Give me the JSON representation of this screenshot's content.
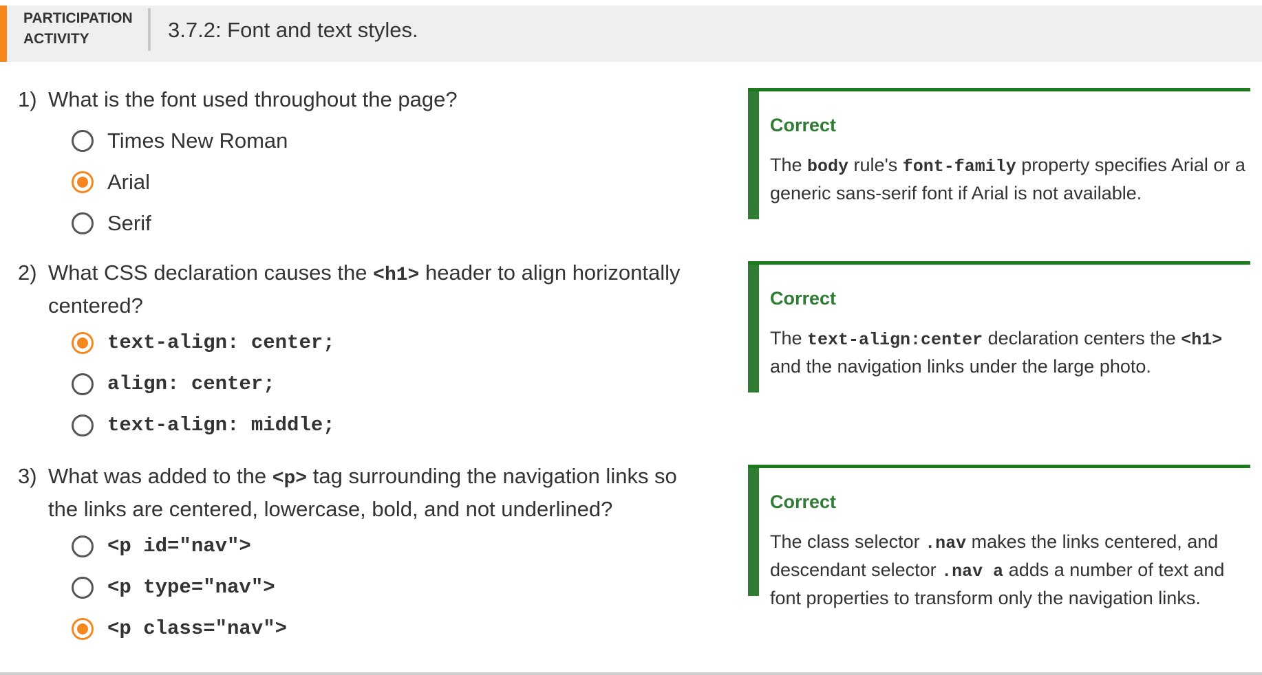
{
  "header": {
    "kind_line1": "PARTICIPATION",
    "kind_line2": "ACTIVITY",
    "title": "3.7.2: Font and text styles."
  },
  "questions": [
    {
      "number": "1)",
      "text_before": "What is the font used throughout the page?",
      "choices": [
        {
          "label": "Times New Roman",
          "selected": false
        },
        {
          "label": "Arial",
          "selected": true
        },
        {
          "label": "Serif",
          "selected": false
        }
      ],
      "feedback": {
        "verdict": "Correct",
        "t1": "The ",
        "c1": "body",
        "t2": " rule's ",
        "c2": "font-family",
        "t3": " property specifies Arial or a generic sans-serif font if Arial is not available."
      }
    },
    {
      "number": "2)",
      "text_before": "What CSS declaration causes the ",
      "text_code": "<h1>",
      "text_after": " header to align horizontally centered?",
      "choices": [
        {
          "label": "text-align: center;",
          "selected": true
        },
        {
          "label": "align: center;",
          "selected": false
        },
        {
          "label": "text-align: middle;",
          "selected": false
        }
      ],
      "feedback": {
        "verdict": "Correct",
        "t1": "The ",
        "c1": "text-align:center",
        "t2": " declaration centers the ",
        "c2": "<h1>",
        "t3": " and the navigation links under the large photo."
      }
    },
    {
      "number": "3)",
      "text_before": "What was added to the ",
      "text_code": "<p>",
      "text_after": " tag surrounding the navigation links so the links are centered, lowercase, bold, and not underlined?",
      "choices": [
        {
          "label": "<p id=\"nav\">",
          "selected": false
        },
        {
          "label": "<p type=\"nav\">",
          "selected": false
        },
        {
          "label": "<p class=\"nav\">",
          "selected": true
        }
      ],
      "feedback": {
        "verdict": "Correct",
        "t1": "The class selector ",
        "c1": ".nav",
        "t2": " makes the links centered, and descendant selector ",
        "c2": ".nav a",
        "t3": " adds a number of text and font properties to transform only the navigation links."
      }
    }
  ],
  "colors": {
    "accent": "#f6871f",
    "correct": "#2e7d32",
    "header_bg": "#efefef"
  }
}
